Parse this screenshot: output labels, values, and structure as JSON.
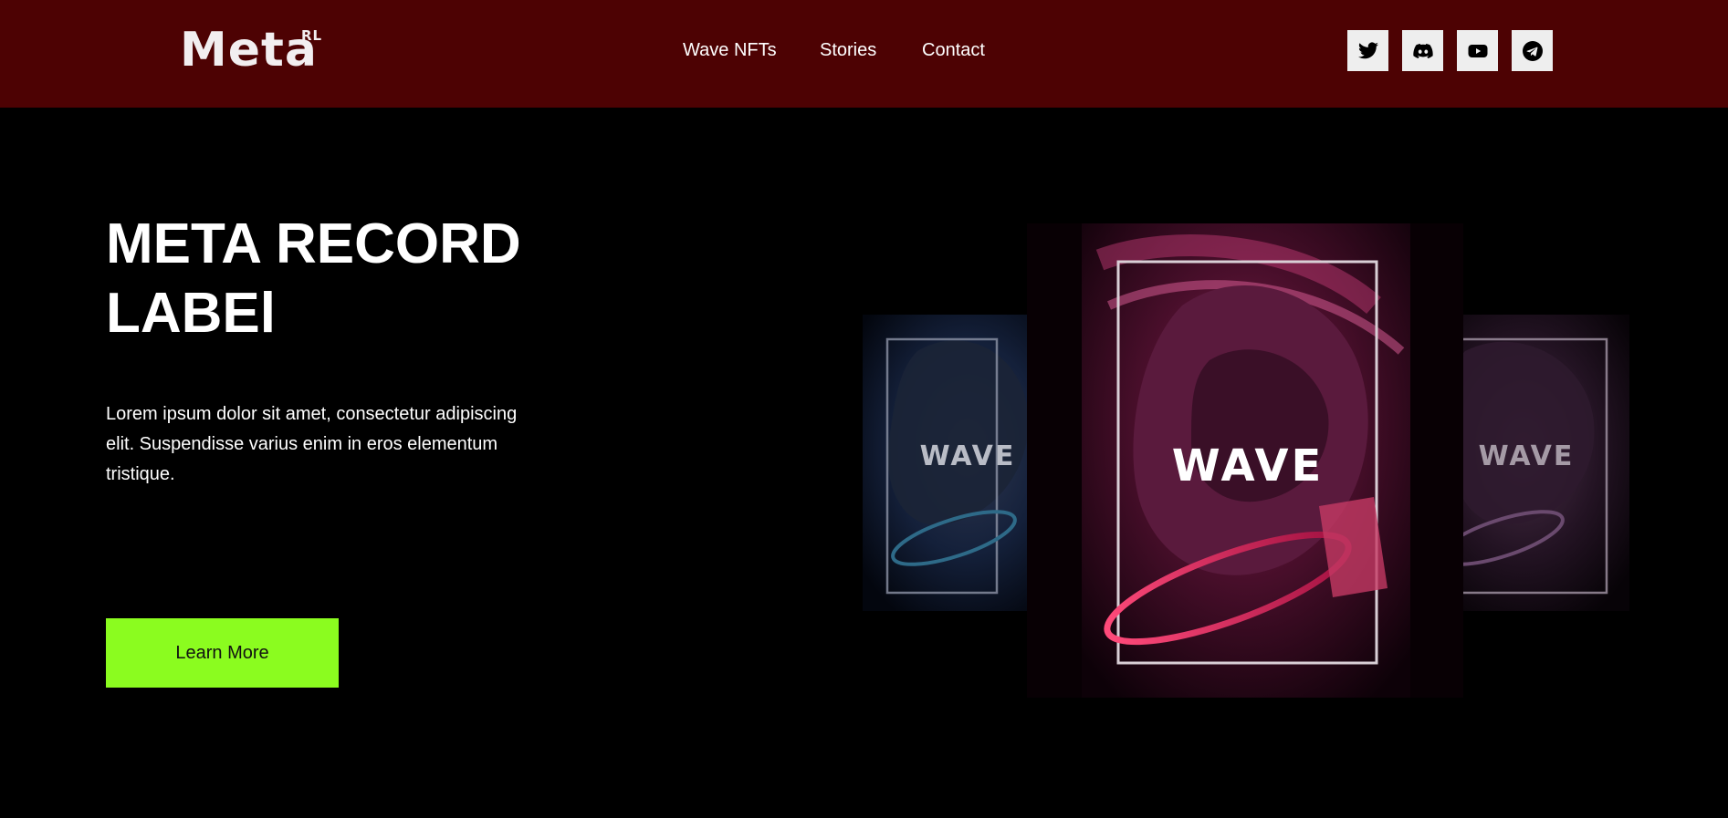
{
  "header": {
    "logo": "Meta",
    "logo_sup": "RL",
    "nav": [
      {
        "label": "Wave NFTs"
      },
      {
        "label": "Stories"
      },
      {
        "label": "Contact"
      }
    ],
    "social": [
      {
        "icon": "twitter-icon"
      },
      {
        "icon": "discord-icon"
      },
      {
        "icon": "youtube-icon"
      },
      {
        "icon": "telegram-icon"
      }
    ]
  },
  "hero": {
    "title": "META RECORD LABEl",
    "text": "Lorem ipsum dolor sit amet, consectetur adipiscing elit. Suspendisse varius enim in eros elementum tristique.",
    "button": "Learn More"
  },
  "art": {
    "card_label": "WAVE"
  },
  "colors": {
    "header_bg": "#4d0203",
    "page_bg": "#000000",
    "accent": "#8bfc1f",
    "social_bg": "#eeeeee"
  }
}
